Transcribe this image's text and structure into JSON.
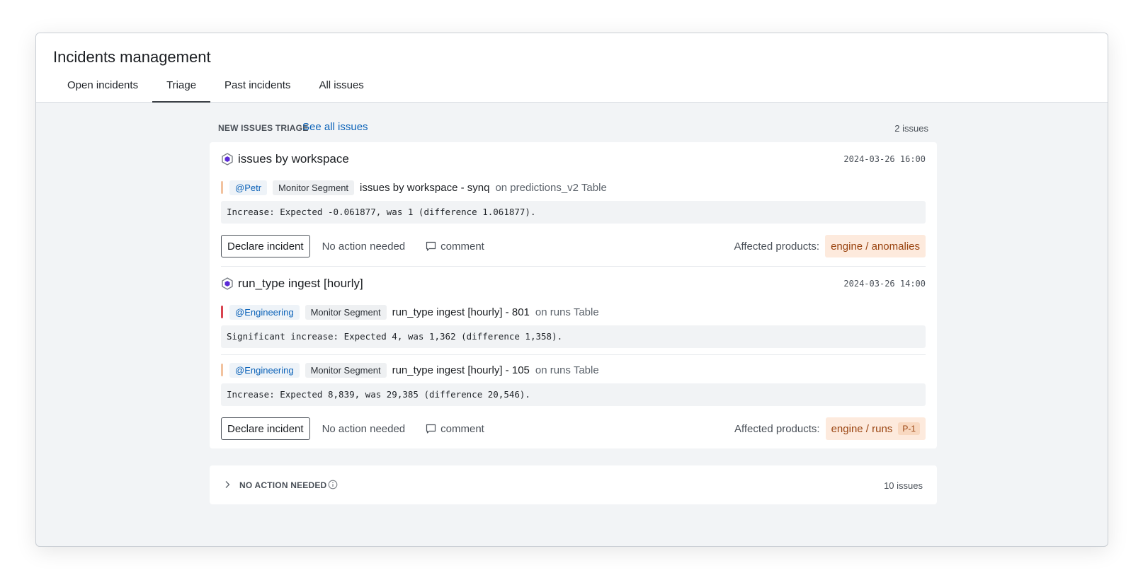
{
  "app": {
    "title": "Incidents management"
  },
  "tabs": [
    {
      "label": "Open incidents",
      "active": false
    },
    {
      "label": "Triage",
      "active": true
    },
    {
      "label": "Past incidents",
      "active": false
    },
    {
      "label": "All issues",
      "active": false
    }
  ],
  "triage": {
    "section_label": "NEW ISSUES TRIAGE",
    "see_all_label": "See all issues",
    "count_label": "2 issues",
    "groups": [
      {
        "title": "issues by workspace",
        "timestamp": "2024-03-26 16:00",
        "icon": "hexagon-monitor-icon",
        "issues": [
          {
            "severity_color": "#f2c29e",
            "owner": "@Petr",
            "segment": "Monitor Segment",
            "name": "issues by workspace - synq",
            "on": "on predictions_v2 Table",
            "message": "Increase: Expected -0.061877, was 1 (difference 1.061877)."
          }
        ],
        "actions": {
          "declare": "Declare incident",
          "no_action": "No action needed",
          "comment": "comment"
        },
        "affected_label": "Affected products:",
        "product": "engine / anomalies",
        "priority": ""
      },
      {
        "title": "run_type ingest [hourly]",
        "timestamp": "2024-03-26 14:00",
        "icon": "hexagon-monitor-icon",
        "issues": [
          {
            "severity_color": "#d9434f",
            "owner": "@Engineering",
            "segment": "Monitor Segment",
            "name": "run_type ingest [hourly] - 801",
            "on": "on runs Table",
            "message": "Significant increase: Expected 4, was 1,362 (difference 1,358)."
          },
          {
            "severity_color": "#f2c29e",
            "owner": "@Engineering",
            "segment": "Monitor Segment",
            "name": "run_type ingest [hourly] - 105",
            "on": "on runs Table",
            "message": "Increase: Expected 8,839, was 29,385 (difference 20,546)."
          }
        ],
        "actions": {
          "declare": "Declare incident",
          "no_action": "No action needed",
          "comment": "comment"
        },
        "affected_label": "Affected products:",
        "product": "engine / runs",
        "priority": "P-1"
      }
    ]
  },
  "no_action": {
    "label": "NO ACTION NEEDED",
    "count_label": "10 issues"
  },
  "colors": {
    "accent": "#0b62b8",
    "monitor_icon": "#5b2bd6",
    "product_bg": "#fdeadd",
    "product_text": "#9a4410"
  }
}
